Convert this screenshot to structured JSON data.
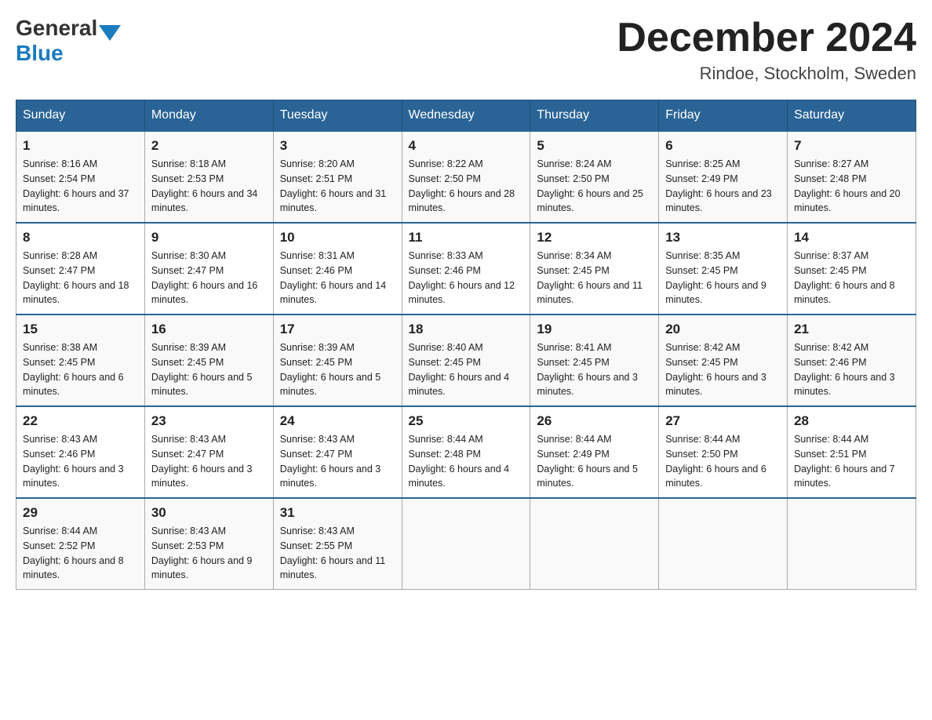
{
  "header": {
    "logo_general": "General",
    "logo_blue": "Blue",
    "month_title": "December 2024",
    "location": "Rindoe, Stockholm, Sweden"
  },
  "weekdays": [
    "Sunday",
    "Monday",
    "Tuesday",
    "Wednesday",
    "Thursday",
    "Friday",
    "Saturday"
  ],
  "weeks": [
    [
      {
        "day": "1",
        "sunrise": "8:16 AM",
        "sunset": "2:54 PM",
        "daylight": "6 hours and 37 minutes."
      },
      {
        "day": "2",
        "sunrise": "8:18 AM",
        "sunset": "2:53 PM",
        "daylight": "6 hours and 34 minutes."
      },
      {
        "day": "3",
        "sunrise": "8:20 AM",
        "sunset": "2:51 PM",
        "daylight": "6 hours and 31 minutes."
      },
      {
        "day": "4",
        "sunrise": "8:22 AM",
        "sunset": "2:50 PM",
        "daylight": "6 hours and 28 minutes."
      },
      {
        "day": "5",
        "sunrise": "8:24 AM",
        "sunset": "2:50 PM",
        "daylight": "6 hours and 25 minutes."
      },
      {
        "day": "6",
        "sunrise": "8:25 AM",
        "sunset": "2:49 PM",
        "daylight": "6 hours and 23 minutes."
      },
      {
        "day": "7",
        "sunrise": "8:27 AM",
        "sunset": "2:48 PM",
        "daylight": "6 hours and 20 minutes."
      }
    ],
    [
      {
        "day": "8",
        "sunrise": "8:28 AM",
        "sunset": "2:47 PM",
        "daylight": "6 hours and 18 minutes."
      },
      {
        "day": "9",
        "sunrise": "8:30 AM",
        "sunset": "2:47 PM",
        "daylight": "6 hours and 16 minutes."
      },
      {
        "day": "10",
        "sunrise": "8:31 AM",
        "sunset": "2:46 PM",
        "daylight": "6 hours and 14 minutes."
      },
      {
        "day": "11",
        "sunrise": "8:33 AM",
        "sunset": "2:46 PM",
        "daylight": "6 hours and 12 minutes."
      },
      {
        "day": "12",
        "sunrise": "8:34 AM",
        "sunset": "2:45 PM",
        "daylight": "6 hours and 11 minutes."
      },
      {
        "day": "13",
        "sunrise": "8:35 AM",
        "sunset": "2:45 PM",
        "daylight": "6 hours and 9 minutes."
      },
      {
        "day": "14",
        "sunrise": "8:37 AM",
        "sunset": "2:45 PM",
        "daylight": "6 hours and 8 minutes."
      }
    ],
    [
      {
        "day": "15",
        "sunrise": "8:38 AM",
        "sunset": "2:45 PM",
        "daylight": "6 hours and 6 minutes."
      },
      {
        "day": "16",
        "sunrise": "8:39 AM",
        "sunset": "2:45 PM",
        "daylight": "6 hours and 5 minutes."
      },
      {
        "day": "17",
        "sunrise": "8:39 AM",
        "sunset": "2:45 PM",
        "daylight": "6 hours and 5 minutes."
      },
      {
        "day": "18",
        "sunrise": "8:40 AM",
        "sunset": "2:45 PM",
        "daylight": "6 hours and 4 minutes."
      },
      {
        "day": "19",
        "sunrise": "8:41 AM",
        "sunset": "2:45 PM",
        "daylight": "6 hours and 3 minutes."
      },
      {
        "day": "20",
        "sunrise": "8:42 AM",
        "sunset": "2:45 PM",
        "daylight": "6 hours and 3 minutes."
      },
      {
        "day": "21",
        "sunrise": "8:42 AM",
        "sunset": "2:46 PM",
        "daylight": "6 hours and 3 minutes."
      }
    ],
    [
      {
        "day": "22",
        "sunrise": "8:43 AM",
        "sunset": "2:46 PM",
        "daylight": "6 hours and 3 minutes."
      },
      {
        "day": "23",
        "sunrise": "8:43 AM",
        "sunset": "2:47 PM",
        "daylight": "6 hours and 3 minutes."
      },
      {
        "day": "24",
        "sunrise": "8:43 AM",
        "sunset": "2:47 PM",
        "daylight": "6 hours and 3 minutes."
      },
      {
        "day": "25",
        "sunrise": "8:44 AM",
        "sunset": "2:48 PM",
        "daylight": "6 hours and 4 minutes."
      },
      {
        "day": "26",
        "sunrise": "8:44 AM",
        "sunset": "2:49 PM",
        "daylight": "6 hours and 5 minutes."
      },
      {
        "day": "27",
        "sunrise": "8:44 AM",
        "sunset": "2:50 PM",
        "daylight": "6 hours and 6 minutes."
      },
      {
        "day": "28",
        "sunrise": "8:44 AM",
        "sunset": "2:51 PM",
        "daylight": "6 hours and 7 minutes."
      }
    ],
    [
      {
        "day": "29",
        "sunrise": "8:44 AM",
        "sunset": "2:52 PM",
        "daylight": "6 hours and 8 minutes."
      },
      {
        "day": "30",
        "sunrise": "8:43 AM",
        "sunset": "2:53 PM",
        "daylight": "6 hours and 9 minutes."
      },
      {
        "day": "31",
        "sunrise": "8:43 AM",
        "sunset": "2:55 PM",
        "daylight": "6 hours and 11 minutes."
      },
      null,
      null,
      null,
      null
    ]
  ]
}
